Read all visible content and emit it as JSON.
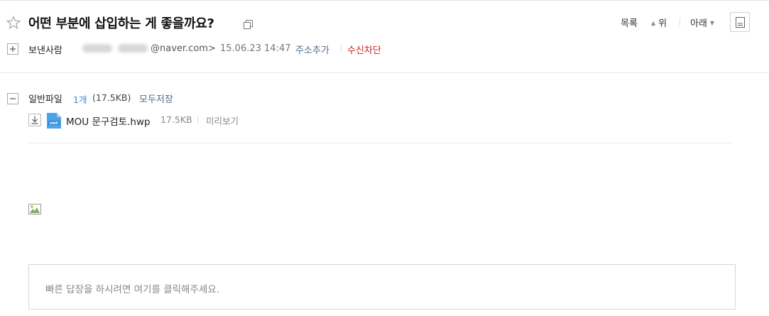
{
  "mail": {
    "subject": "어떤 부분에 삽입하는 게 좋을까요?"
  },
  "toolbar": {
    "list_label": "목록",
    "up_label": "위",
    "down_label": "아래"
  },
  "sender": {
    "label": "보낸사람",
    "email_suffix": "@naver.com>",
    "date": "15.06.23 14:47",
    "add_address_label": "주소추가",
    "block_label": "수신차단"
  },
  "attachments": {
    "label": "일반파일",
    "count": "1개",
    "total_size": "(17.5KB)",
    "save_all_label": "모두저장",
    "files": [
      {
        "name": "MOU 문구검토.hwp",
        "size": "17.5KB",
        "preview_label": "미리보기",
        "icon": "hwp-file-icon"
      }
    ]
  },
  "quick_reply": {
    "placeholder": "빠른 답장을 하시려면 여기를 클릭해주세요."
  },
  "colors": {
    "link": "#4a6d8f",
    "danger": "#cc2222",
    "count_blue": "#3a8cd6",
    "hwp_blue": "#4da3e8"
  }
}
